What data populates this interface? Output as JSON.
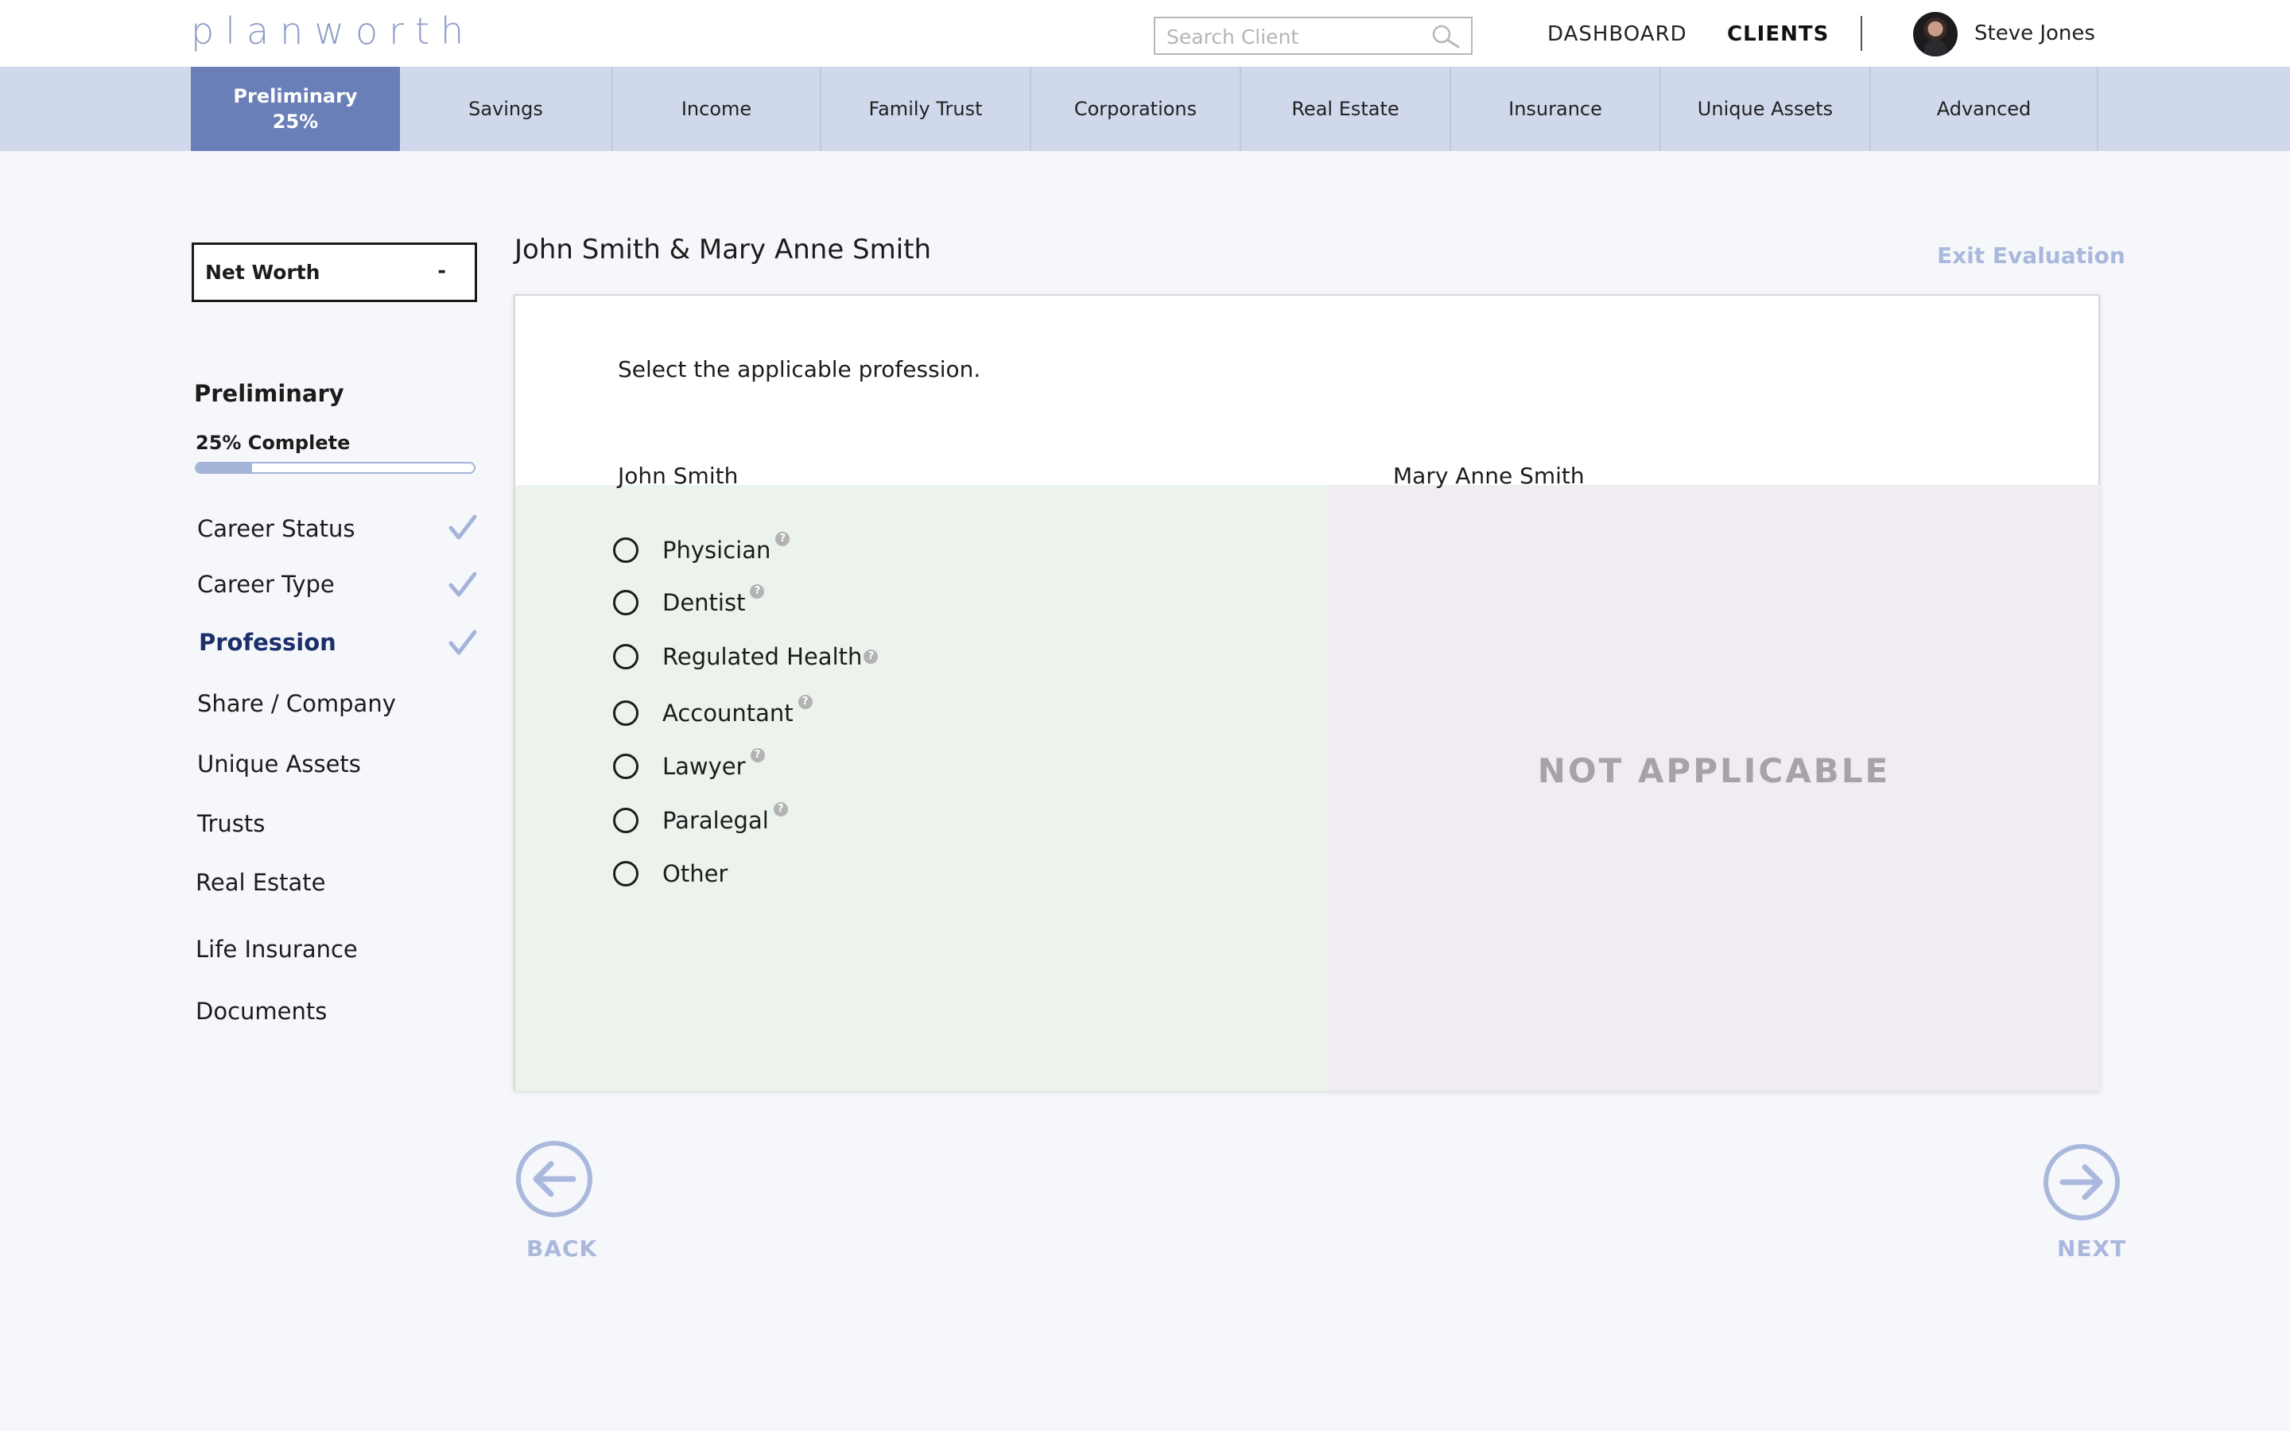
{
  "app": {
    "logo": "planworth"
  },
  "header": {
    "search_placeholder": "Search Client",
    "nav": {
      "dashboard": "DASHBOARD",
      "clients": "CLIENTS"
    },
    "user": {
      "name": "Steve Jones"
    }
  },
  "tabs": [
    {
      "label": "Preliminary",
      "sub": "25%",
      "active": true
    },
    {
      "label": "Savings"
    },
    {
      "label": "Income"
    },
    {
      "label": "Family Trust"
    },
    {
      "label": "Corporations"
    },
    {
      "label": "Real Estate"
    },
    {
      "label": "Insurance"
    },
    {
      "label": "Unique Assets"
    },
    {
      "label": "Advanced"
    }
  ],
  "sidebar": {
    "networth_label": "Net Worth",
    "networth_toggle": "-",
    "section_title": "Preliminary",
    "complete_text": "25% Complete",
    "progress": 0.2,
    "items": [
      {
        "label": "Career Status",
        "checked": true
      },
      {
        "label": "Career Type",
        "checked": true
      },
      {
        "label": "Profession",
        "checked": true,
        "current": true
      },
      {
        "label": "Share / Company"
      },
      {
        "label": "Unique Assets"
      },
      {
        "label": "Trusts"
      },
      {
        "label": "Real Estate"
      },
      {
        "label": "Life Insurance"
      },
      {
        "label": "Documents"
      }
    ]
  },
  "main": {
    "clients_title": "John Smith & Mary Anne Smith",
    "exit_label": "Exit Evaluation",
    "question": "Select the applicable profession.",
    "person_a": "John Smith",
    "person_b": "Mary Anne Smith",
    "options": [
      {
        "label": "Physician",
        "help": "?"
      },
      {
        "label": "Dentist",
        "help": "?"
      },
      {
        "label": "Regulated Health",
        "help": "?"
      },
      {
        "label": "Accountant",
        "help": "?"
      },
      {
        "label": "Lawyer",
        "help": "?"
      },
      {
        "label": "Paralegal",
        "help": "?"
      },
      {
        "label": "Other"
      }
    ],
    "not_applicable": "NOT  APPLICABLE",
    "back_label": "BACK",
    "next_label": "NEXT"
  },
  "colors": {
    "accent": "#6a7fb7",
    "tab_bg": "#d0d8ec",
    "muted_accent": "#a9b8dc",
    "current_item": "#1b2f6b",
    "panel_a": "#ebf3ec",
    "panel_b": "#f1ecf2"
  },
  "icons": {
    "search": "search-icon",
    "check": "check-icon",
    "help": "help-icon",
    "back": "arrow-left-circle-icon",
    "next": "arrow-right-circle-icon"
  }
}
